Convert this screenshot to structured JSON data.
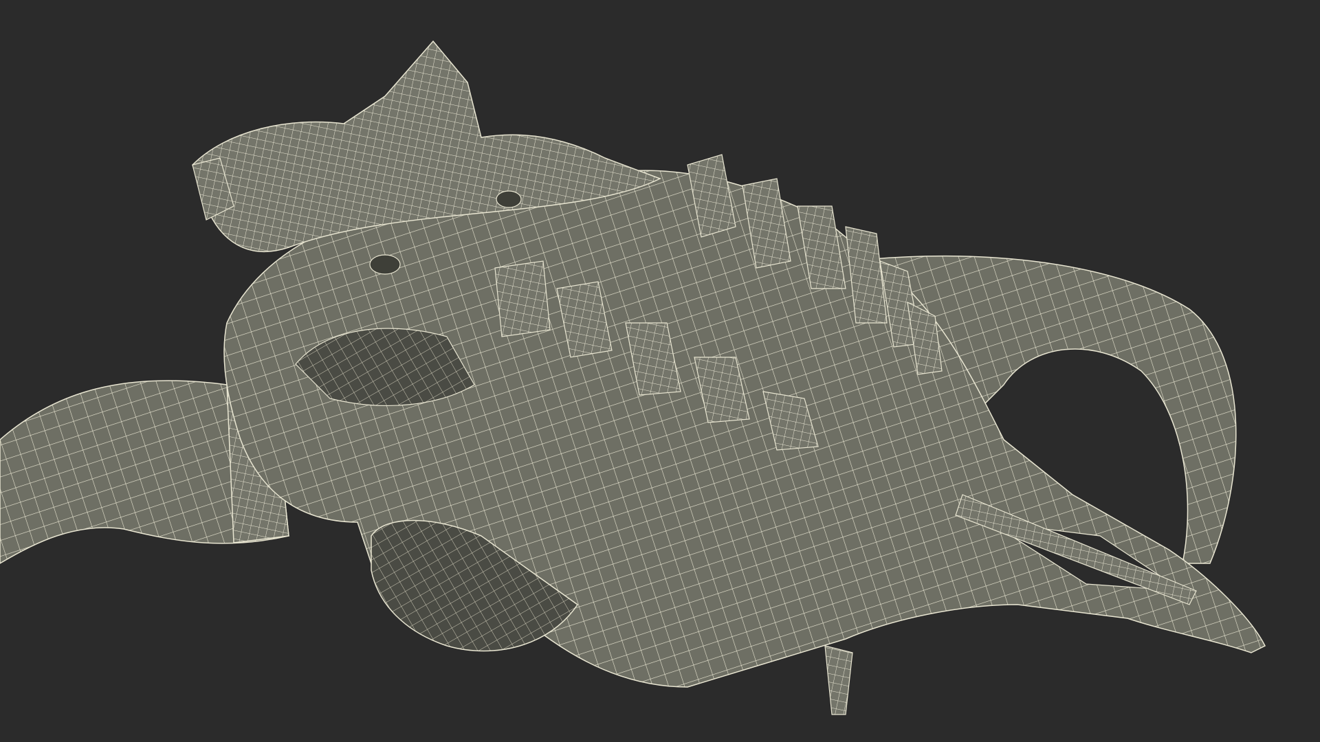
{
  "scene": {
    "subject": "wireframe-skull-render",
    "background_color": "#2b2b2b",
    "mesh_fill_color": "#6e6f64",
    "mesh_shadow_color": "#3e3f38",
    "wire_color": "#e9e6d2"
  }
}
